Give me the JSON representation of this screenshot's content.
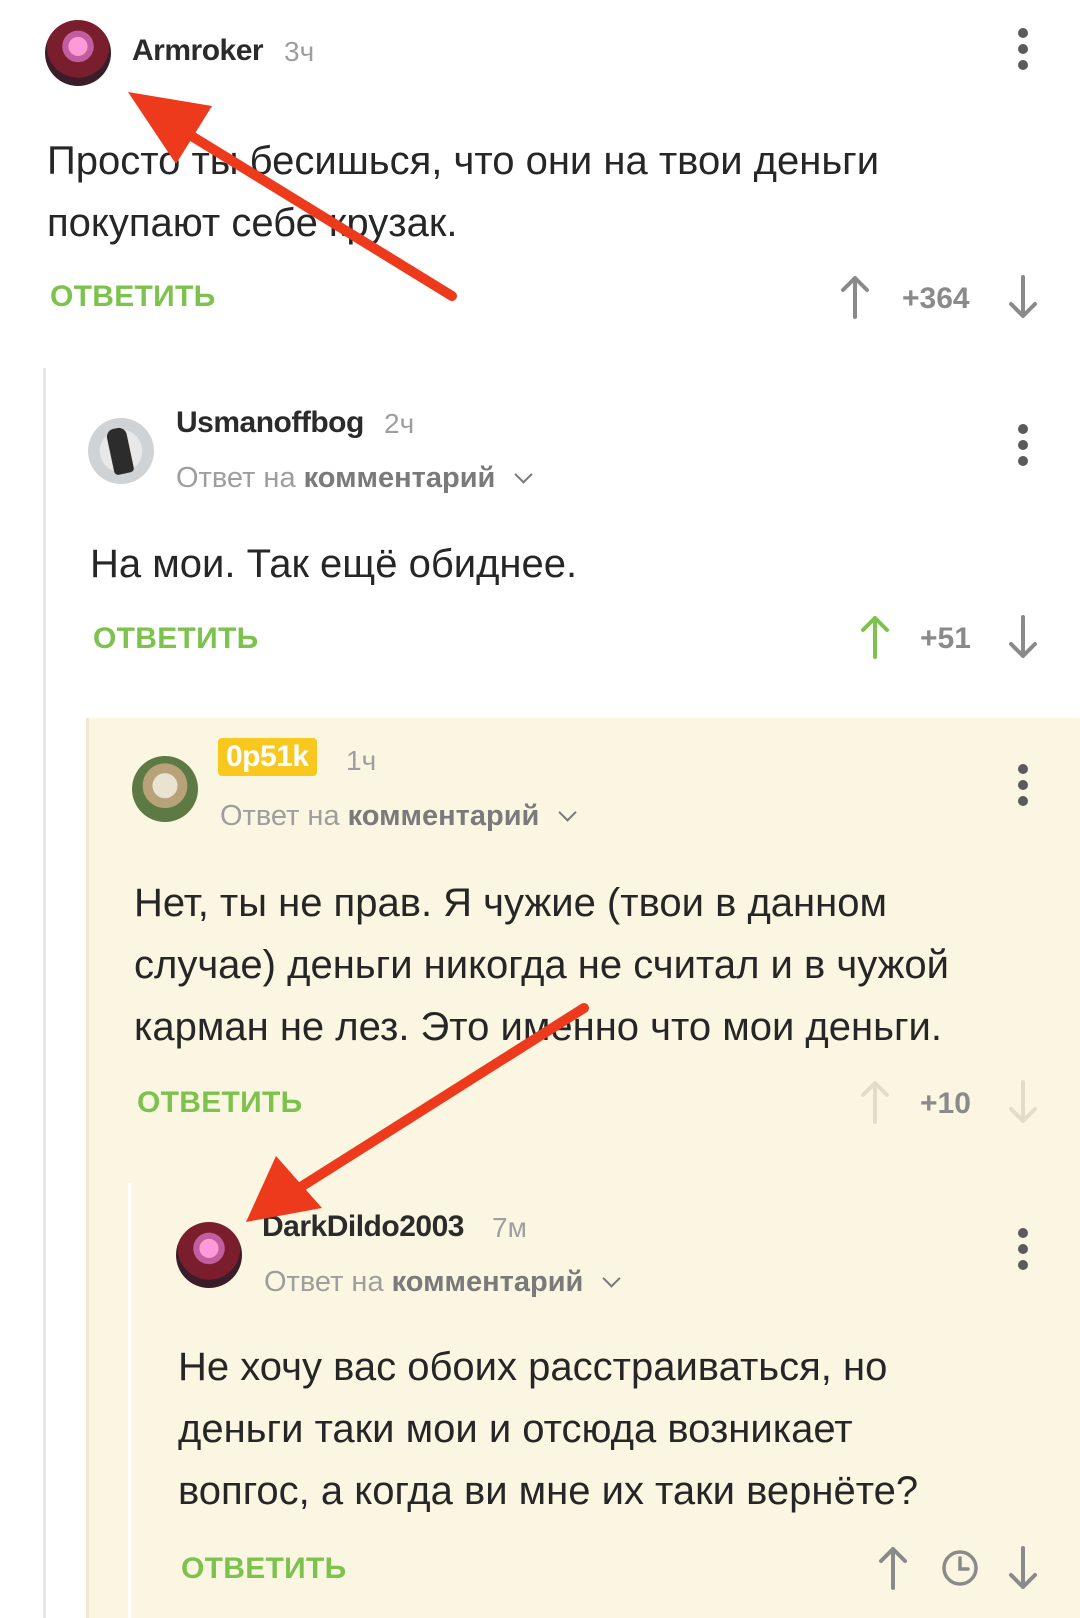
{
  "comments": [
    {
      "username": "Armroker",
      "time": "3ч",
      "text_lines": [
        "Просто ты бесишься, что они на твои деньги",
        "покупают себе крузак."
      ],
      "reply_label": "ОТВЕТИТЬ",
      "score": "+364"
    },
    {
      "username": "Usmanoffbog",
      "time": "2ч",
      "reply_to_prefix": "Ответ на",
      "reply_to_target": "комментарий",
      "text_lines": [
        "На мои. Так ещё обиднее."
      ],
      "reply_label": "ОТВЕТИТЬ",
      "score": "+51"
    },
    {
      "username": "0p51k",
      "time": "1ч",
      "reply_to_prefix": "Ответ на",
      "reply_to_target": "комментарий",
      "text_lines": [
        "Нет, ты не прав. Я чужие (твои в данном",
        "случае) деньги никогда не считал и в чужой",
        "карман не лез. Это именно что мои деньги."
      ],
      "reply_label": "ОТВЕТИТЬ",
      "score": "+10"
    },
    {
      "username": "DarkDildo2003",
      "time": "7м",
      "reply_to_prefix": "Ответ на",
      "reply_to_target": "комментарий",
      "text_lines": [
        "Не хочу вас обоих расстраиваться, но",
        "деньги таки мои и отсюда возникает",
        "вопгос, а когда ви мне их таки вернёте?"
      ],
      "reply_label": "ОТВЕТИТЬ",
      "score_icon": "clock-icon"
    }
  ],
  "colors": {
    "reply_green": "#7cc24d",
    "upvote_active": "#7cc24d",
    "highlight_bg": "#fbf6e1",
    "badge_yellow": "#f8c81e",
    "annotation_red": "#ee3a1c"
  }
}
